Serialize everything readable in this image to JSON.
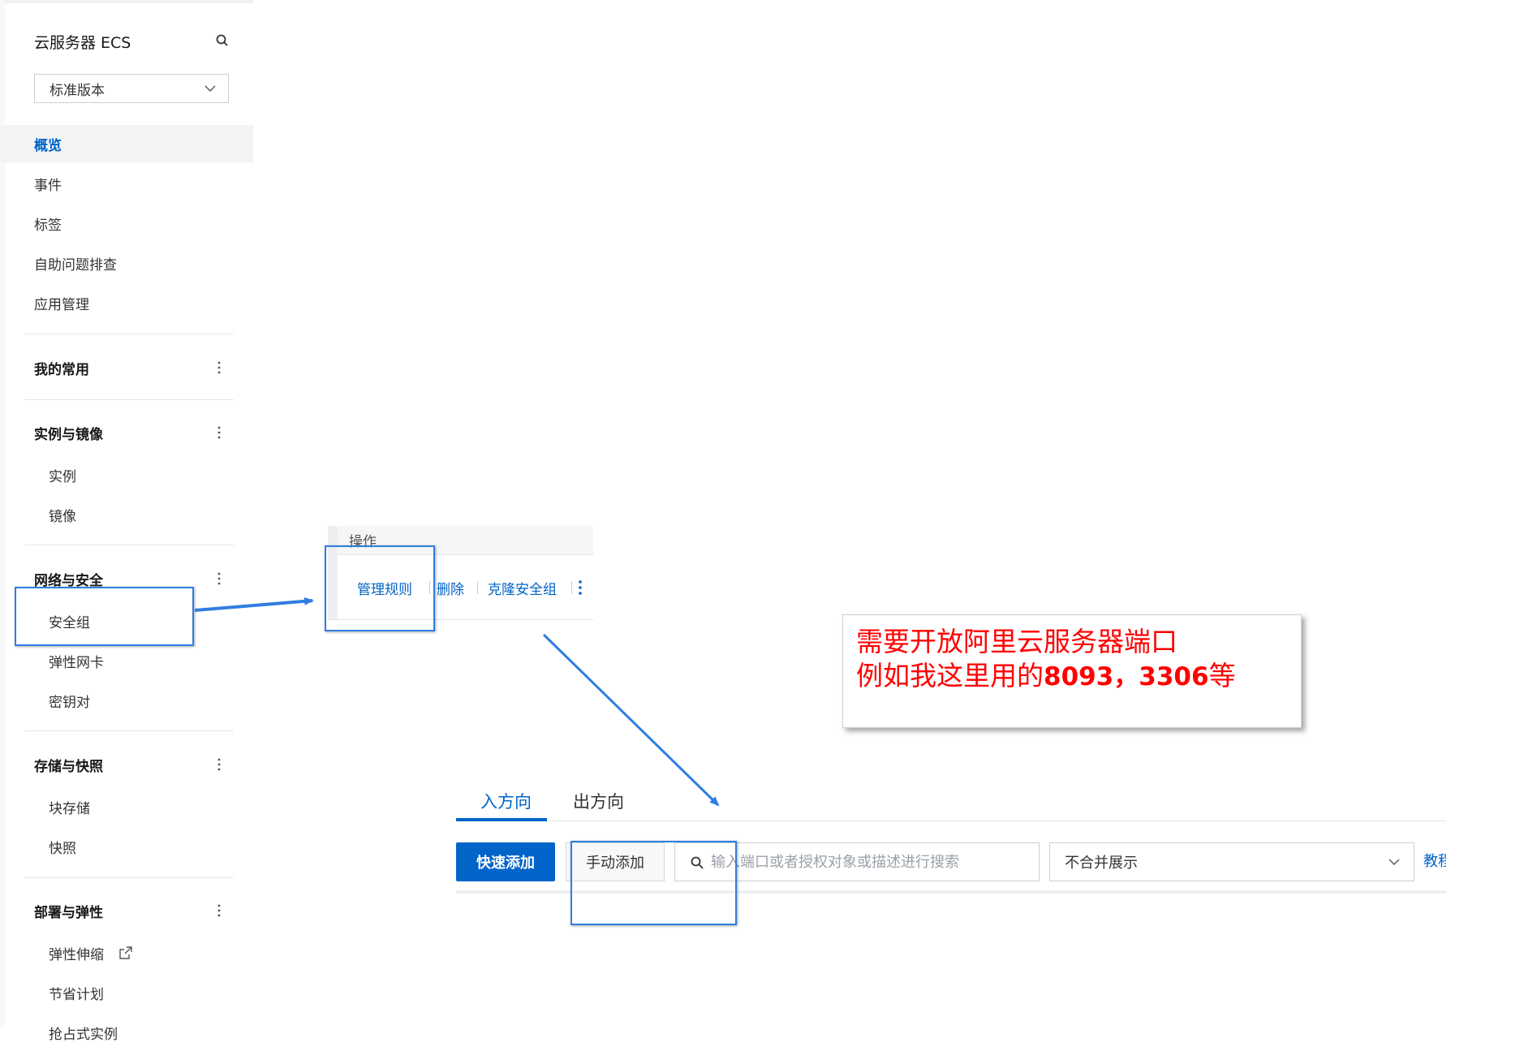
{
  "sidebar": {
    "title": "云服务器 ECS",
    "version_select": {
      "value": "标准版本"
    },
    "top_items": [
      {
        "label": "概览",
        "active": true
      },
      {
        "label": "事件"
      },
      {
        "label": "标签"
      },
      {
        "label": "自助问题排查"
      },
      {
        "label": "应用管理"
      }
    ],
    "groups": [
      {
        "label": "我的常用",
        "items": []
      },
      {
        "label": "实例与镜像",
        "items": [
          "实例",
          "镜像"
        ]
      },
      {
        "label": "网络与安全",
        "items": [
          "安全组",
          "弹性网卡",
          "密钥对"
        ]
      },
      {
        "label": "存储与快照",
        "items": [
          "块存储",
          "快照"
        ]
      },
      {
        "label": "部署与弹性",
        "items": [
          "弹性伸缩",
          "节省计划",
          "抢占式实例"
        ]
      }
    ]
  },
  "operations": {
    "header": "操作",
    "links": [
      "管理规则",
      "删除",
      "克隆安全组"
    ]
  },
  "note": {
    "line1": "需要开放阿里云服务器端口",
    "line2_prefix": "例如我这里用的",
    "line2_ports": "8093，3306",
    "line2_suffix": "等"
  },
  "rules": {
    "tabs": [
      "入方向",
      "出方向"
    ],
    "active_tab": "入方向",
    "quick_add_label": "快速添加",
    "manual_add_label": "手动添加",
    "search_placeholder": "输入端口或者授权对象或描述进行搜索",
    "merge_select_value": "不合并展示",
    "tutorial_link": "教程"
  },
  "colors": {
    "brand_blue": "#0064c8",
    "highlight_blue": "#2f7de1",
    "note_red": "#ff0000"
  },
  "icons": {
    "search": "search-icon",
    "chevron": "chevron-down-icon",
    "more": "more-vertical-icon",
    "external": "external-link-icon"
  }
}
